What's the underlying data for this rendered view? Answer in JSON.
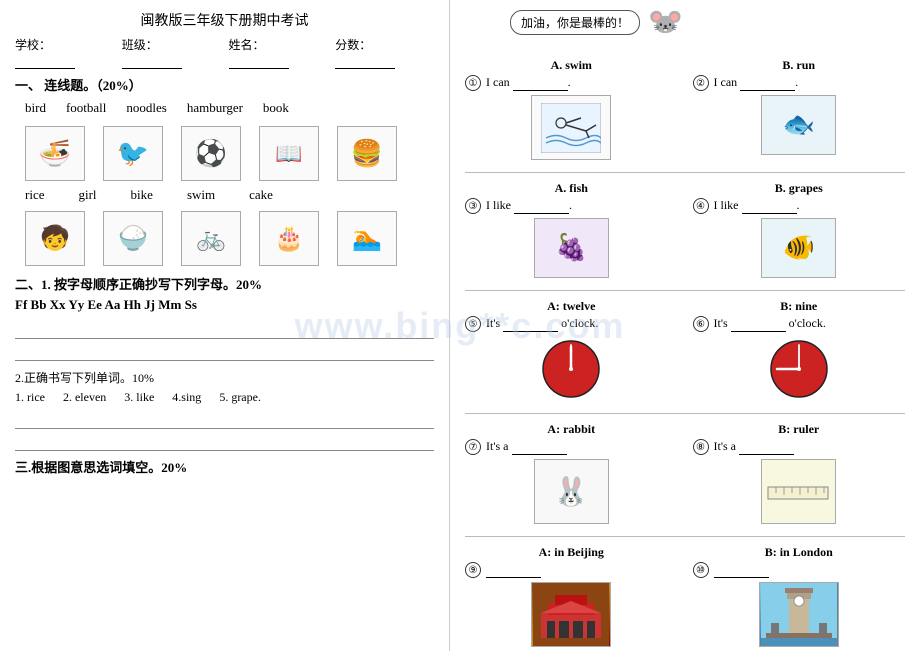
{
  "left": {
    "title": "闽教版三年级下册期中考试",
    "school_line": "学校：______  班级：______  姓名：______  分数：______",
    "section1": {
      "header": "一、 连线题。（20%）",
      "words_top": [
        "bird",
        "football",
        "noodles",
        "hamburger",
        "book"
      ],
      "words_bottom": [
        "rice",
        "girl",
        "bike",
        "swim",
        "cake"
      ]
    },
    "section2": {
      "header": "二、1. 按字母顺序正确抄写下列字母。20%",
      "alphabet": "Ff  Bb  Xx  Yy  Ee  Aa  Hh  Jj  Mm  Ss",
      "sub2_header": "2.正确书写下列单词。10%",
      "words": [
        "1. rice",
        "2. eleven",
        "3. like",
        "4.sing",
        "5. grape."
      ]
    },
    "section3": {
      "header": "三.根据图意思选词填空。20%"
    }
  },
  "right": {
    "motivation": "加油，你是最棒的！",
    "exercises": {
      "ex1": {
        "optionA": "A. swim",
        "optionB": "B. run",
        "q1": "① I can ________.",
        "q2": "② I can ________."
      },
      "ex2": {
        "optionA": "A. fish",
        "optionB": "B. grapes",
        "q3": "③ I like ________.",
        "q4": "④ I like ________."
      },
      "ex3": {
        "optionA": "A: twelve",
        "optionB": "B: nine",
        "q5": "⑤ It's ______ o'clock.",
        "q6": "⑥ It's ______ o'clock."
      },
      "ex4": {
        "optionA": "A: rabbit",
        "optionB": "B: ruler",
        "q7": "⑦ It's a ________",
        "q8": "⑧ It's a ________"
      },
      "ex5": {
        "optionA": "A: in Beijing",
        "optionB": "B: in London",
        "q9_num": "⑨",
        "q10_num": "⑩"
      }
    }
  }
}
